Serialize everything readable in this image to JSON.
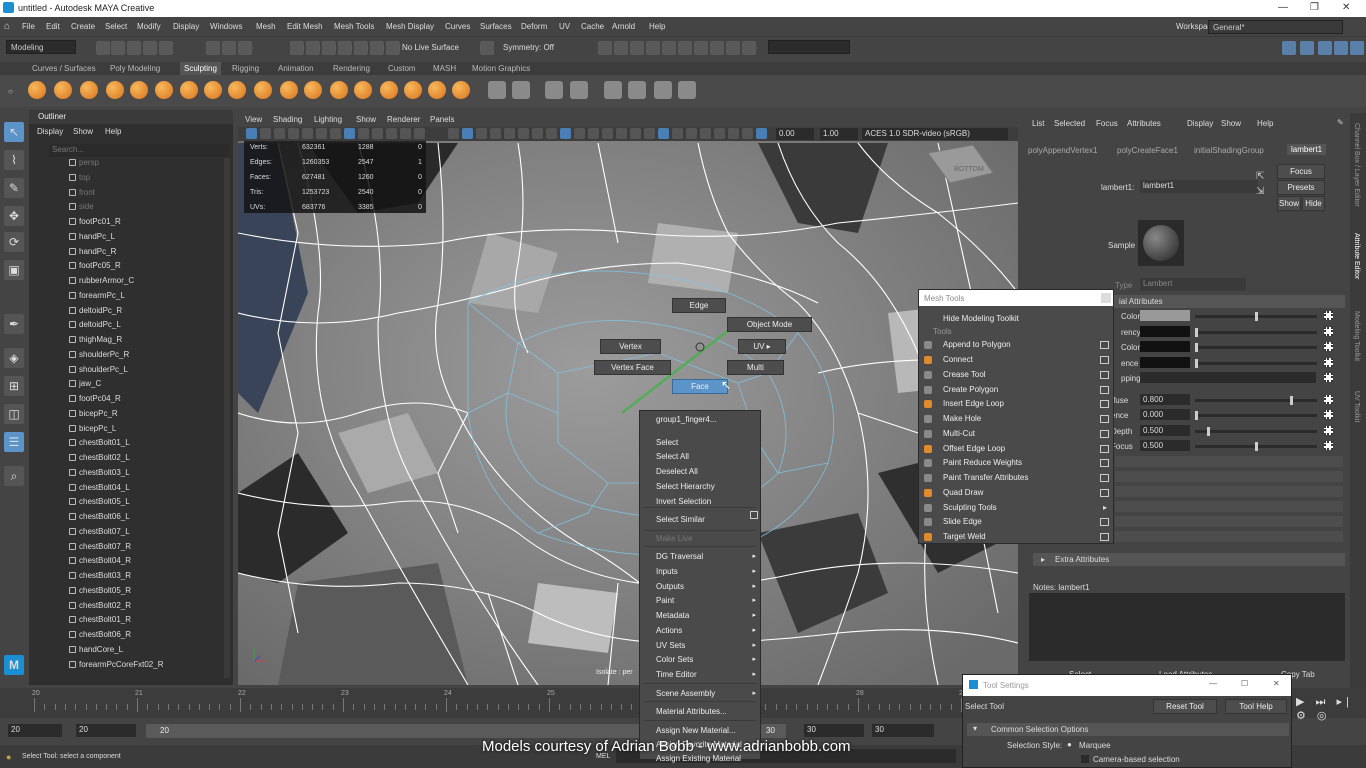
{
  "window": {
    "title": "untitled - Autodesk MAYA Creative"
  },
  "menu": [
    "File",
    "Edit",
    "Create",
    "Select",
    "Modify",
    "Display",
    "Windows",
    "Mesh",
    "Edit Mesh",
    "Mesh Tools",
    "Mesh Display",
    "Curves",
    "Surfaces",
    "Deform",
    "UV",
    "Cache",
    "Arnold",
    "Help"
  ],
  "workspace": {
    "label": "Workspace:",
    "value": "General*"
  },
  "status": {
    "mode": "Modeling",
    "live": "No Live Surface",
    "symmetry": "Symmetry: Off"
  },
  "shelf_tabs": [
    "Curves / Surfaces",
    "Poly Modeling",
    "Sculpting",
    "Rigging",
    "Animation",
    "Rendering",
    "Custom",
    "MASH",
    "Motion Graphics"
  ],
  "shelf_active": "Sculpting",
  "outliner": {
    "tab": "Outliner",
    "menu": [
      "Display",
      "Show",
      "Help"
    ],
    "search": "Search...",
    "items": [
      "persp",
      "top",
      "front",
      "side",
      "footPc01_R",
      "handPc_L",
      "handPc_R",
      "footPc05_R",
      "rubberArmor_C",
      "forearmPc_L",
      "deltoidPc_R",
      "deltoidPc_L",
      "thighMag_R",
      "shoulderPc_R",
      "shoulderPc_L",
      "jaw_C",
      "footPc04_R",
      "bicepPc_R",
      "bicepPc_L",
      "chestBolt01_L",
      "chestBolt02_L",
      "chestBolt03_L",
      "chestBolt04_L",
      "chestBolt05_L",
      "chestBolt06_L",
      "chestBolt07_L",
      "chestBolt07_R",
      "chestBolt04_R",
      "chestBolt03_R",
      "chestBolt05_R",
      "chestBolt02_R",
      "chestBolt01_R",
      "chestBolt06_R",
      "handCore_L",
      "forearmPcCoreFxt02_R"
    ]
  },
  "viewport": {
    "menu": [
      "View",
      "Shading",
      "Lighting",
      "Show",
      "Renderer",
      "Panels"
    ],
    "val1": "0.00",
    "val2": "1.00",
    "colorspace": "ACES 1.0 SDR-video (sRGB)",
    "cube": "BOTTOM",
    "isolate": "Isolate : per",
    "hud": [
      [
        "Verts:",
        "632361",
        "1288",
        "0"
      ],
      [
        "Edges:",
        "1260353",
        "2547",
        "1"
      ],
      [
        "Faces:",
        "627481",
        "1260",
        "0"
      ],
      [
        "Tris:",
        "1253723",
        "2540",
        "0"
      ],
      [
        "UVs:",
        "683776",
        "3385",
        "0"
      ]
    ]
  },
  "marking_menu": {
    "edge": "Edge",
    "object_mode": "Object Mode",
    "vertex": "Vertex",
    "uv": "UV",
    "vertex_face": "Vertex Face",
    "multi": "Multi",
    "face": "Face"
  },
  "context_menu": {
    "header": "group1_finger4...",
    "items": [
      "Select",
      "Select All",
      "Deselect All",
      "Select Hierarchy",
      "Invert Selection",
      "Select Similar",
      "Make Live",
      "DG Traversal",
      "Inputs",
      "Outputs",
      "Paint",
      "Metadata",
      "Actions",
      "UV Sets",
      "Color Sets",
      "Time Editor",
      "Scene Assembly",
      "Material Attributes...",
      "Assign New Material...",
      "Assign Favorite Material",
      "Assign Existing Material"
    ]
  },
  "mesh_tools": {
    "title": "Mesh Tools",
    "hide": "Hide Modeling Toolkit",
    "section": "Tools",
    "items": [
      "Append to Polygon",
      "Connect",
      "Crease Tool",
      "Create Polygon",
      "Insert Edge Loop",
      "Make Hole",
      "Multi-Cut",
      "Offset Edge Loop",
      "Paint Reduce Weights",
      "Paint Transfer Attributes",
      "Quad Draw",
      "Sculpting Tools",
      "Slide Edge",
      "Target Weld"
    ]
  },
  "attribute_editor": {
    "menu": [
      "List",
      "Selected",
      "Focus",
      "Attributes",
      "Display",
      "Show",
      "Help"
    ],
    "tabs": [
      "polyAppendVertex1",
      "polyCreateFace1",
      "initialShadingGroup",
      "lambert1"
    ],
    "node_label": "lambert1:",
    "node_value": "lambert1",
    "buttons": [
      "Focus",
      "Presets",
      "Show",
      "Hide"
    ],
    "sample": "Sample",
    "type_label": "Type",
    "type_value": "Lambert",
    "section": "ial Attributes",
    "rows": [
      [
        "Color",
        ""
      ],
      [
        "rency",
        ""
      ],
      [
        "Color",
        ""
      ],
      [
        "ence",
        ""
      ],
      [
        "pping",
        ""
      ],
      [
        "ffuse",
        "0.800"
      ],
      [
        "ence",
        "0.000"
      ],
      [
        "Depth",
        "0.500"
      ],
      [
        "Focus",
        "0.500"
      ]
    ],
    "extra": "Extra Attributes",
    "notes": "Notes:  lambert1",
    "bottom": [
      "Select",
      "Load Attributes",
      "Copy Tab"
    ],
    "vert_tabs": [
      "Channel Box / Layer Editor",
      "Attribute Editor",
      "Modeling Toolkit",
      "UV Toolkit"
    ]
  },
  "timeline": {
    "ticks": [
      "20",
      "21",
      "22",
      "23",
      "24",
      "25",
      "26",
      "27",
      "28",
      "29"
    ],
    "start": "20",
    "end": "20",
    "range_start": "20",
    "range_val": "30",
    "end2": "30",
    "end3": "30"
  },
  "tool_settings": {
    "title": "Tool Settings",
    "tool": "Select Tool",
    "reset": "Reset Tool",
    "help": "Tool Help",
    "section": "Common Selection Options",
    "style_label": "Selection Style:",
    "marquee": "Marquee",
    "camera": "Camera-based selection"
  },
  "cmdline": {
    "lang": "MEL",
    "help": "Select Tool: select a component"
  },
  "caption": "Models courtesy of Adrian Bobb - www.adrianbobb.com",
  "colors": {
    "highlight": "#5a94c9",
    "accent_green": "#4caf50",
    "wire": "#ffffff",
    "wire_blue": "#7fc7e8"
  }
}
